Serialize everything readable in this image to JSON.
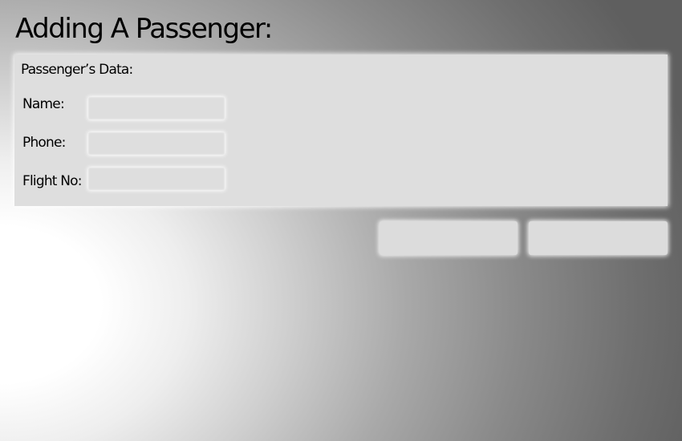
{
  "page": {
    "title": "Adding A Passenger:"
  },
  "passenger_form": {
    "section_title": "Passenger’s Data:",
    "fields": [
      {
        "label": "Name:",
        "value": "",
        "placeholder": ""
      },
      {
        "label": "Phone:",
        "value": "",
        "placeholder": ""
      },
      {
        "label": "Flight No:",
        "value": "",
        "placeholder": ""
      }
    ]
  },
  "actions": {
    "left_button_label": "",
    "right_button_label": ""
  },
  "colors": {
    "panel_background": "#dedede",
    "button_background": "#dcdcdc",
    "text": "#000000"
  }
}
